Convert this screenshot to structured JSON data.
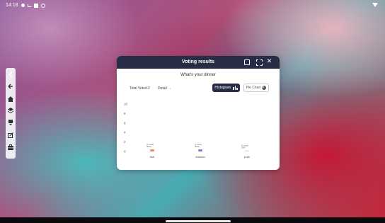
{
  "status_bar": {
    "time": "14:18"
  },
  "dialog": {
    "title": "Voting results",
    "question": "What's your dinner",
    "total_voted": "Total Voted:2",
    "detail_label": "Detail",
    "histogram_label": "Histogram",
    "pie_chart_label": "Pie Chart"
  },
  "colors": {
    "accent": "#272d45",
    "fish": "#f08a5d",
    "chicken": "#9b6fe0",
    "pork": "#d9d9e0"
  },
  "icons": {
    "sidebar": [
      "collapse-icon",
      "back-icon",
      "home-icon",
      "layers-icon",
      "screen-icon",
      "edit-icon",
      "toolbox-icon"
    ],
    "header": [
      "share-icon",
      "fullscreen-icon",
      "close-icon"
    ]
  },
  "chart_data": {
    "type": "bar",
    "categories": [
      "fish",
      "chicken",
      "pork"
    ],
    "values": [
      1,
      1,
      0
    ],
    "data_labels": [
      [
        "[1 votes]",
        "(50%)"
      ],
      [
        "[1 votes]",
        "(50%)"
      ],
      [
        "[0 votes]",
        "(0%)"
      ]
    ],
    "yticks": [
      "10",
      "8",
      "6",
      "4",
      "2",
      "0"
    ],
    "ylim": [
      0,
      10
    ],
    "grid": false
  }
}
